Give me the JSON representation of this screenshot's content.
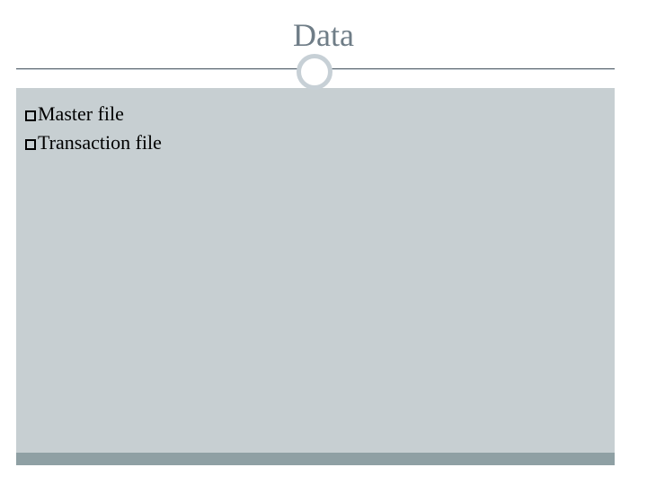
{
  "title": "Data",
  "bullets": [
    {
      "label": "Master file"
    },
    {
      "label": "Transaction file"
    }
  ],
  "colors": {
    "title": "#6f7d87",
    "body_bg": "#c7cfd2",
    "footer_bar": "#8fa0a4",
    "circle_border": "#c7d0d6"
  }
}
